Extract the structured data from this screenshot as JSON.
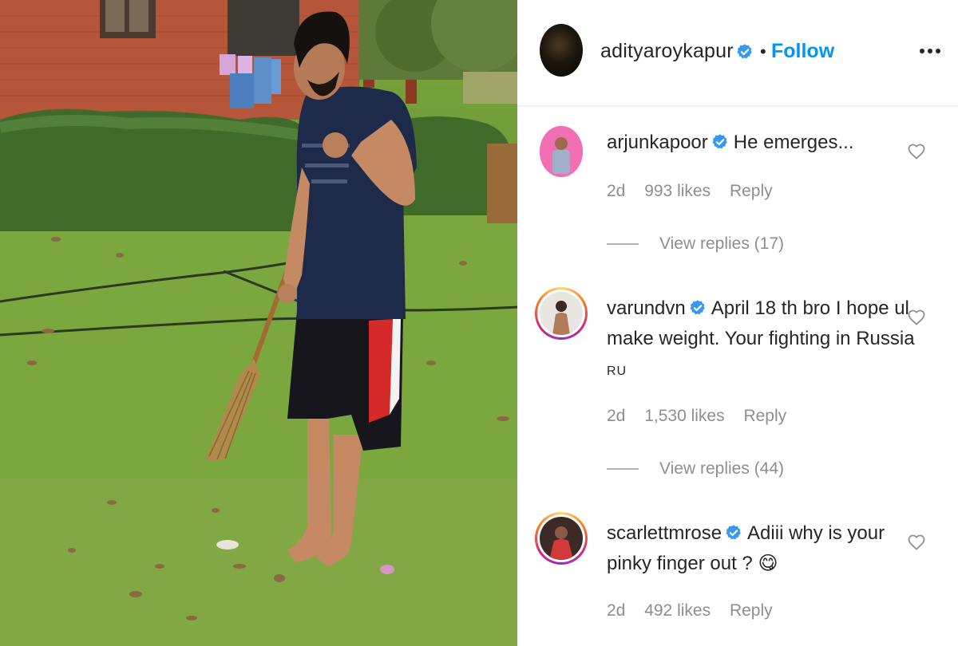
{
  "post": {
    "author": "adityaroykapur",
    "follow_label": "Follow",
    "separator": "•"
  },
  "comments": [
    {
      "username": "arjunkapoor",
      "text": "He emerges...",
      "time": "2d",
      "likes": "993 likes",
      "reply_label": "Reply",
      "view_replies": "View replies (17)"
    },
    {
      "username": "varundvn",
      "text": "April 18 th bro I hope ul make weight. Your fighting in Russia",
      "flag": "RU",
      "time": "2d",
      "likes": "1,530 likes",
      "reply_label": "Reply",
      "view_replies": "View replies (44)"
    },
    {
      "username": "scarlettmrose",
      "text": "Adiii why is your pinky finger out ?",
      "emoji": "😋",
      "time": "2d",
      "likes": "492 likes",
      "reply_label": "Reply"
    }
  ],
  "icons": {
    "verified": "verified-badge-icon",
    "more": "more-options-icon",
    "heart": "heart-outline-icon"
  },
  "colors": {
    "follow": "#0095f6",
    "verified": "#3897f0",
    "meta": "#8e8e8e",
    "text": "#262626"
  }
}
